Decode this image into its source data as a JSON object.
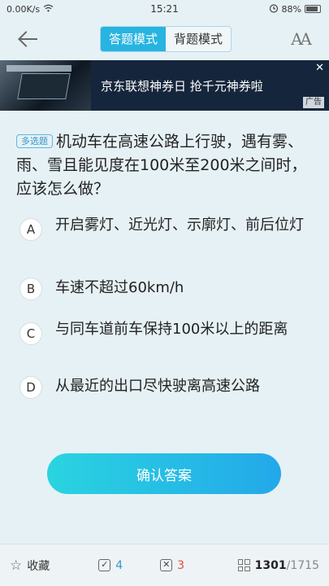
{
  "status": {
    "network_speed": "0.00K/s",
    "time": "15:21",
    "battery": "88%"
  },
  "header": {
    "modes": [
      "答题模式",
      "背题模式"
    ],
    "font_icon_label": "AA"
  },
  "ad": {
    "text": "京东联想神券日 抢千元神券啦",
    "tag": "广告",
    "close": "✕"
  },
  "question": {
    "type_tag": "多选题",
    "text": "机动车在高速公路上行驶，遇有雾、雨、雪且能见度在100米至200米之间时，应该怎么做？",
    "options": [
      {
        "letter": "A",
        "text": "开启雾灯、近光灯、示廓灯、前后位灯"
      },
      {
        "letter": "B",
        "text": "车速不超过60km/h"
      },
      {
        "letter": "C",
        "text": "与同车道前车保持100米以上的距离"
      },
      {
        "letter": "D",
        "text": "从最近的出口尽快驶离高速公路"
      }
    ]
  },
  "confirm_label": "确认答案",
  "bottom": {
    "favorite_label": "收藏",
    "correct_count": "4",
    "wrong_count": "3",
    "current": "1301",
    "total": "/1715"
  },
  "colors": {
    "accent": "#27b4e0",
    "background": "#e6f1f5",
    "correct": "#3a97c8",
    "wrong": "#e74c3c"
  }
}
